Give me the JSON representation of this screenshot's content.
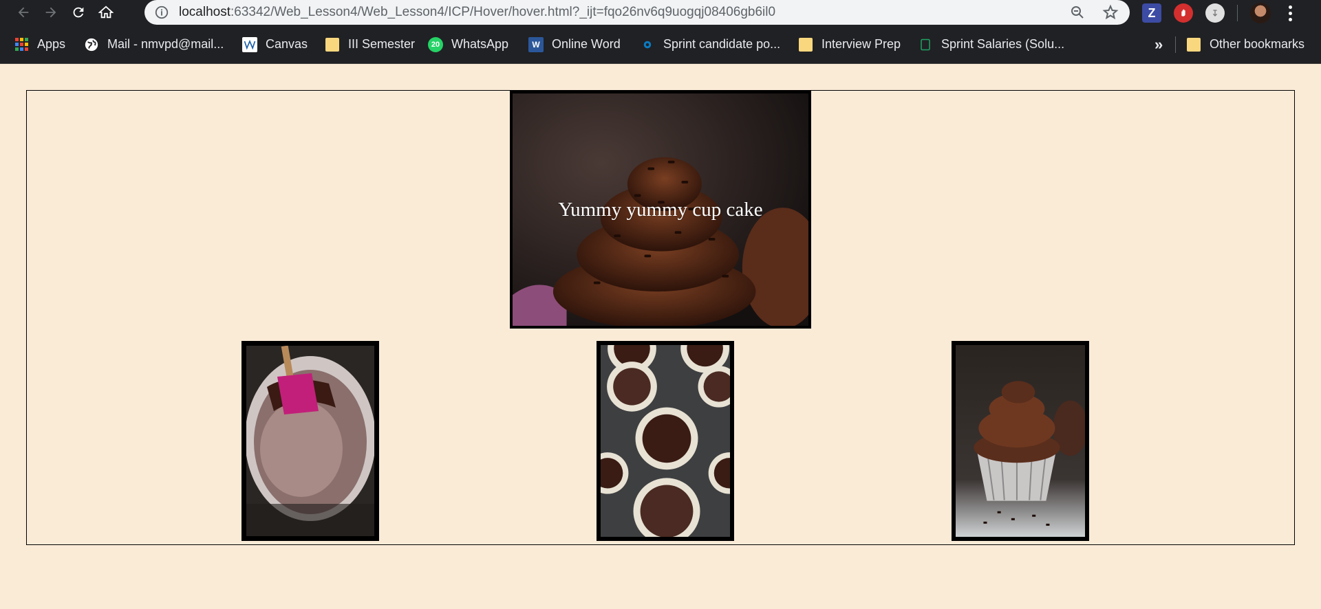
{
  "browser": {
    "url_host": "localhost",
    "url_rest": ":63342/Web_Lesson4/Web_Lesson4/ICP/Hover/hover.html?_ijt=fqo26nv6q9uogqj08406gb6il0",
    "extensions": {
      "z_label": "Z"
    }
  },
  "bookmarks": {
    "items": [
      {
        "label": "Apps",
        "icon": "apps-grid-icon"
      },
      {
        "label": "Mail - nmvpd@mail...",
        "icon": "globe-icon"
      },
      {
        "label": "Canvas",
        "icon": "canvas-icon"
      },
      {
        "label": "III Semester",
        "icon": "folder-icon"
      },
      {
        "label": "WhatsApp",
        "icon": "whatsapp-icon",
        "badge": "20"
      },
      {
        "label": "Online Word",
        "icon": "word-icon"
      },
      {
        "label": "Sprint candidate po...",
        "icon": "sprint-icon"
      },
      {
        "label": "Interview Prep",
        "icon": "folder-icon"
      },
      {
        "label": "Sprint Salaries (Solu...",
        "icon": "sheet-icon"
      }
    ],
    "overflow": "»",
    "other": "Other bookmarks"
  },
  "page": {
    "hero_caption": "Yummy yummy cup cake",
    "images": [
      {
        "name": "chocolate-cupcake-hero"
      },
      {
        "name": "batter-bowl-with-spatula"
      },
      {
        "name": "batter-in-muffin-tin"
      },
      {
        "name": "frosted-cupcake"
      }
    ]
  }
}
